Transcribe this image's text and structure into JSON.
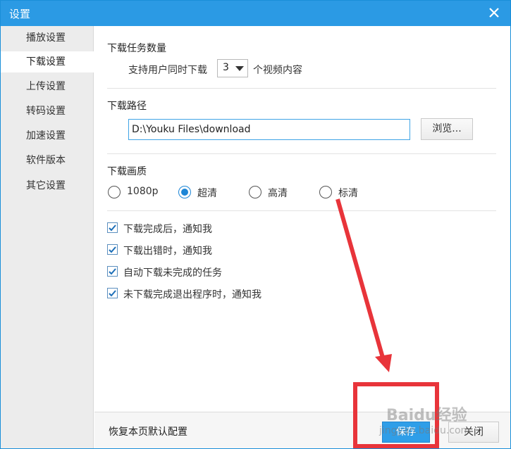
{
  "window": {
    "title": "设置"
  },
  "sidebar": {
    "items": [
      {
        "label": "播放设置"
      },
      {
        "label": "下载设置"
      },
      {
        "label": "上传设置"
      },
      {
        "label": "转码设置"
      },
      {
        "label": "加速设置"
      },
      {
        "label": "软件版本"
      },
      {
        "label": "其它设置"
      }
    ],
    "active_index": 1
  },
  "download_count": {
    "title": "下载任务数量",
    "prefix": "支持用户同时下载",
    "value": "3",
    "suffix": "个视频内容"
  },
  "download_path": {
    "title": "下载路径",
    "value": "D:\\Youku Files\\download",
    "browse_label": "浏览..."
  },
  "download_quality": {
    "title": "下载画质",
    "options": [
      {
        "label": "1080p",
        "checked": false
      },
      {
        "label": "超清",
        "checked": true
      },
      {
        "label": "高清",
        "checked": false
      },
      {
        "label": "标清",
        "checked": false
      }
    ]
  },
  "notifications": [
    {
      "label": "下载完成后，通知我",
      "checked": true
    },
    {
      "label": "下载出错时，通知我",
      "checked": true
    },
    {
      "label": "自动下载未完成的任务",
      "checked": true
    },
    {
      "label": "未下载完成退出程序时，通知我",
      "checked": true
    }
  ],
  "footer": {
    "restore_label": "恢复本页默认配置",
    "save_label": "保存",
    "close_label": "关闭"
  },
  "annotation": {
    "arrow_color": "#e8343a",
    "box_color": "#e8343a"
  },
  "watermark": {
    "brand": "Baidu经验",
    "url": "jingyan.baidu.com"
  },
  "colors": {
    "titlebar": "#2b9ae4",
    "accent": "#1d86d6",
    "save_button": "#2f9ee8"
  }
}
